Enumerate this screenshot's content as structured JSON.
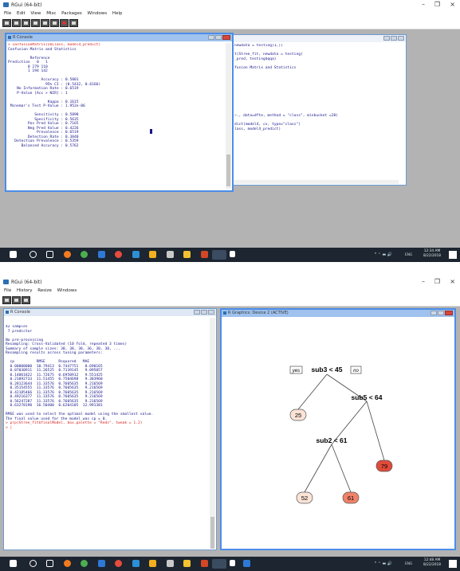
{
  "screen1": {
    "app_title": "RGui (64-bit)",
    "window_controls": [
      "–",
      "❐",
      "×"
    ],
    "menu": [
      "File",
      "Edit",
      "View",
      "Misc",
      "Packages",
      "Windows",
      "Help"
    ],
    "console_title": "R Console",
    "console_lines": [
      {
        "text": "> confusionMatrix(x$Class, model4_predict)",
        "cls": "red"
      },
      {
        "text": "Confusion Matrix and Statistics",
        "cls": ""
      },
      {
        "text": "",
        "cls": ""
      },
      {
        "text": "          Reference",
        "cls": ""
      },
      {
        "text": "Prediction   0   1",
        "cls": ""
      },
      {
        "text": "         0 279 110",
        "cls": ""
      },
      {
        "text": "         1 194 142",
        "cls": ""
      },
      {
        "text": "",
        "cls": ""
      },
      {
        "text": "               Accuracy : 0.5801",
        "cls": ""
      },
      {
        "text": "                 95% CI : (0.5432, 0.6166)",
        "cls": ""
      },
      {
        "text": "    No Information Rate : 0.6519",
        "cls": ""
      },
      {
        "text": "    P-Value [Acc > NIR] : 1",
        "cls": ""
      },
      {
        "text": "",
        "cls": ""
      },
      {
        "text": "                  Kappa : 0.1615",
        "cls": ""
      },
      {
        "text": " Mcnemar's Test P-Value : 1.952e-06",
        "cls": ""
      },
      {
        "text": "",
        "cls": ""
      },
      {
        "text": "            Sensitivity : 0.5898",
        "cls": ""
      },
      {
        "text": "            Specificity : 0.5635",
        "cls": ""
      },
      {
        "text": "         Pos Pred Value : 0.7165",
        "cls": ""
      },
      {
        "text": "         Neg Pred Value : 0.4226",
        "cls": ""
      },
      {
        "text": "             Prevalence : 0.6519",
        "cls": ""
      },
      {
        "text": "         Detection Rate : 0.3840",
        "cls": ""
      },
      {
        "text": "   Detection Prevalence : 0.5359",
        "cls": ""
      },
      {
        "text": "      Balanced Accuracy : 0.5762",
        "cls": ""
      }
    ],
    "bg_console_lines": [
      "newdata = testing[1,])",
      "",
      "t(Stree_fit, newdata = testing)",
      "_pred, testing$qqa)",
      "",
      "fusion Matrix and Statistics",
      "",
      "",
      "",
      "",
      "",
      "",
      "",
      "",
      "",
      "",
      "~., data=dfte, method = \"class\", minbucket =20)",
      "",
      "dict(model4, cv, type=\"class\")",
      "lass, model4_predict)"
    ],
    "clock_time": "12:34 AM",
    "clock_date": "8/22/2018",
    "lang": "ENG"
  },
  "screen2": {
    "app_title": "RGui (64-bit)",
    "window_controls": [
      "–",
      "❐",
      "×"
    ],
    "menu": [
      "File",
      "History",
      "Resize",
      "Windows"
    ],
    "console_title": "R Console",
    "graphics_title": "R Graphics: Device 2 (ACTIVE)",
    "console_lines": [
      {
        "text": "42 samples",
        "cls": ""
      },
      {
        "text": " 7 predictor",
        "cls": ""
      },
      {
        "text": "",
        "cls": ""
      },
      {
        "text": "No pre-processing",
        "cls": ""
      },
      {
        "text": "Resampling: Cross-Validated (10 fold, repeated 3 times)",
        "cls": ""
      },
      {
        "text": "Summary of sample sizes: 38, 38, 38, 36, 38, 38, ...",
        "cls": ""
      },
      {
        "text": "Resampling results across tuning parameters:",
        "cls": ""
      },
      {
        "text": "",
        "cls": ""
      },
      {
        "text": "  cp          RMSE      Rsquared   MAE",
        "cls": ""
      },
      {
        "text": "  0.00000000  10.79413  0.7447751   8.690165",
        "cls": ""
      },
      {
        "text": "  0.07030911  11.26525  0.7139145   9.095057",
        "cls": ""
      },
      {
        "text": "  0.14061822  11.72675  0.6950912   9.551425",
        "cls": ""
      },
      {
        "text": "  0.21092733  11.51455  0.7504698   9.383960",
        "cls": ""
      },
      {
        "text": "  0.28123644  11.33576  0.7605635   9.216569",
        "cls": ""
      },
      {
        "text": "  0.35154555  11.33576  0.7605635   9.216569",
        "cls": ""
      },
      {
        "text": "  0.42185466  11.33576  0.7605635   9.216569",
        "cls": ""
      },
      {
        "text": "  0.49216377  11.33576  0.7605635   9.216569",
        "cls": ""
      },
      {
        "text": "  0.56247287  11.33576  0.7605635   9.216569",
        "cls": ""
      },
      {
        "text": "  0.63278190  16.50400  0.6204105  12.991381",
        "cls": ""
      },
      {
        "text": "",
        "cls": ""
      },
      {
        "text": "RMSE was used to select the optimal model using the smallest value.",
        "cls": ""
      },
      {
        "text": "The final value used for the model was cp = 0.",
        "cls": ""
      },
      {
        "text": "> prp(Stree_fit$finalModel, box.palette = \"Reds\", tweak = 1.2)",
        "cls": "red"
      },
      {
        "text": "> |",
        "cls": "cursor"
      }
    ],
    "tree": {
      "yes_label": "yes",
      "no_label": "no",
      "split_root": "sub3 < 45",
      "split_right": "sub5 < 64",
      "split_rl": "sub2 < 61",
      "leaves": [
        "25",
        "52",
        "61",
        "79"
      ],
      "leaf_colors": {
        "25": "#fbe3d6",
        "52": "#fbe3d6",
        "61": "#f0826a",
        "79": "#e04b3a"
      }
    },
    "clock_time": "12:48 AM",
    "clock_date": "8/22/2018",
    "lang": "ENG"
  },
  "taskbar_icons": [
    "windows-start",
    "search",
    "task-view",
    "firefox",
    "chrome",
    "store",
    "chrome-alt",
    "explorer",
    "excel",
    "lock",
    "notes",
    "powerpoint",
    "r-gui"
  ],
  "colors": {
    "console_text": "#16168a",
    "console_command": "#d62020",
    "taskbar": "#1c2530",
    "mdi_bg": "#b3b3b3"
  }
}
